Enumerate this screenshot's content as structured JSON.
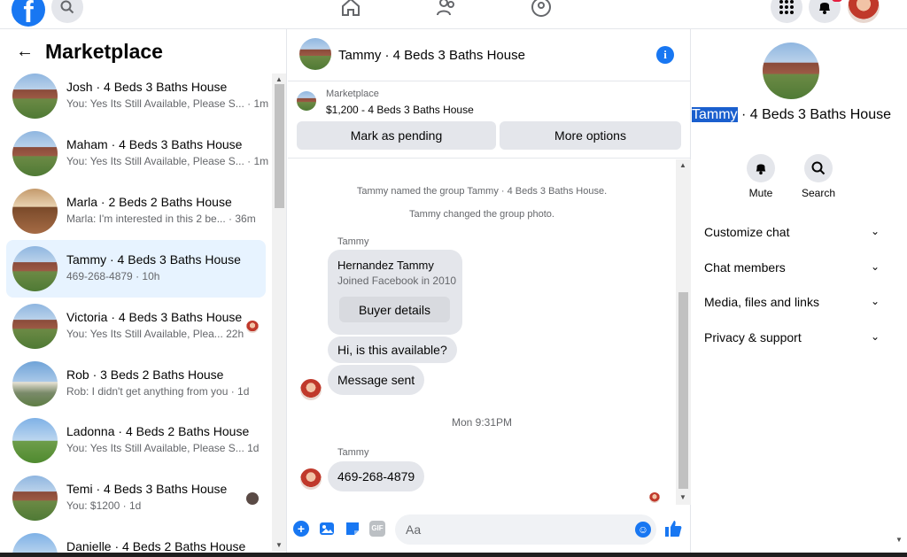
{
  "topbar": {
    "logo": "f",
    "icons": [
      "search-icon",
      "home-icon",
      "friends-icon",
      "groups-icon",
      "menu-grid-icon",
      "bell-icon",
      "profile-avatar"
    ]
  },
  "left": {
    "title": "Marketplace",
    "conversations": [
      {
        "name": "Josh · 4 Beds 3 Baths House",
        "snippet": "You: Yes Its Still Available, Please S... · 1m"
      },
      {
        "name": "Maham · 4 Beds 3 Baths House",
        "snippet": "You: Yes Its Still Available, Please S... · 1m"
      },
      {
        "name": "Marla · 2 Beds 2 Baths House",
        "snippet": "Marla: I'm interested in this 2 be... · 36m"
      },
      {
        "name": "Tammy · 4 Beds 3 Baths House",
        "snippet": "469-268-4879 · 10h"
      },
      {
        "name": "Victoria · 4 Beds 3 Baths House",
        "snippet": "You: Yes Its Still Available, Plea...  22h"
      },
      {
        "name": "Rob · 3 Beds 2 Baths House",
        "snippet": "Rob: I didn't get anything from you · 1d"
      },
      {
        "name": "Ladonna · 4 Beds 2 Baths House",
        "snippet": "You: Yes Its Still Available, Please S...  1d"
      },
      {
        "name": "Temi · 4 Beds 3 Baths House",
        "snippet": "You: $1200 · 1d"
      },
      {
        "name": "Danielle · 4 Beds 2 Baths House",
        "snippet": ""
      }
    ]
  },
  "chat": {
    "title": "Tammy · 4 Beds 3 Baths House",
    "marketplace_label": "Marketplace",
    "listing": "$1,200 - 4 Beds 3 Baths House",
    "mark_pending": "Mark as pending",
    "more_options": "More options",
    "system1": "Tammy named the group Tammy · 4 Beds 3 Baths House.",
    "system2": "Tammy changed the group photo.",
    "sender1": "Tammy",
    "card_name": "Hernandez Tammy",
    "card_sub": "Joined Facebook in 2010",
    "buyer_details": "Buyer details",
    "msg1": "Hi, is this available?",
    "msg2": "Message sent",
    "timestamp": "Mon 9:31PM",
    "sender2": "Tammy",
    "msg3": "469-268-4879",
    "composer_placeholder": "Aa"
  },
  "right": {
    "name_highlight": "Tammy",
    "name_rest": " · 4 Beds 3 Baths House",
    "mute": "Mute",
    "search": "Search",
    "rows": [
      "Customize chat",
      "Chat members",
      "Media, files and links",
      "Privacy & support"
    ]
  },
  "colors": {
    "accent": "#1877f2",
    "active_row": "#e7f3ff",
    "bubble": "#e4e6eb"
  }
}
